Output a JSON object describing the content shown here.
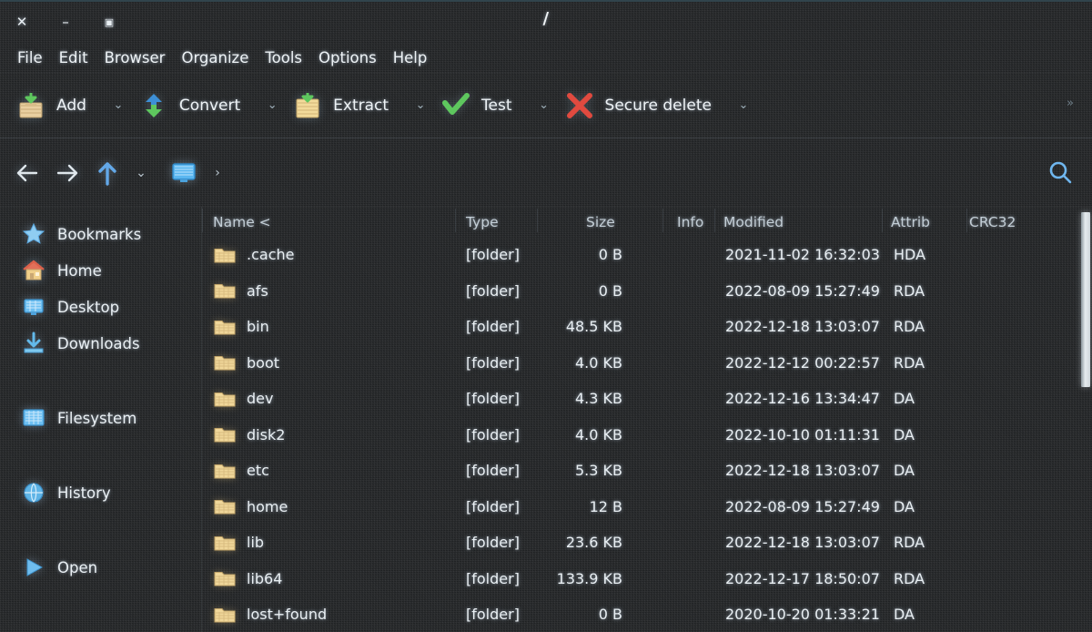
{
  "window": {
    "title": "/",
    "controls": [
      {
        "name": "close",
        "glyph": "✕"
      },
      {
        "name": "minimize",
        "glyph": "–"
      },
      {
        "name": "maximize",
        "glyph": "▣"
      }
    ]
  },
  "menubar": {
    "items": [
      {
        "label": "File"
      },
      {
        "label": "Edit"
      },
      {
        "label": "Browser"
      },
      {
        "label": "Organize"
      },
      {
        "label": "Tools"
      },
      {
        "label": "Options"
      },
      {
        "label": "Help"
      }
    ]
  },
  "toolbar": {
    "overflow_glyph": "»",
    "buttons": [
      {
        "label": "Add",
        "icon": "add-archive-icon",
        "caret": "⌄"
      },
      {
        "label": "Convert",
        "icon": "convert-icon",
        "caret": "⌄"
      },
      {
        "label": "Extract",
        "icon": "extract-icon",
        "caret": "⌄"
      },
      {
        "label": "Test",
        "icon": "test-checkmark-icon",
        "caret": "⌄"
      },
      {
        "label": "Secure delete",
        "icon": "secure-delete-icon",
        "caret": "⌄"
      }
    ]
  },
  "navbar": {
    "back_icon": "back-arrow-icon",
    "forward_icon": "forward-arrow-icon",
    "up_icon": "up-arrow-icon",
    "history_caret": "⌄",
    "computer_icon": "computer-icon",
    "path_caret": "›",
    "search_icon": "search-icon"
  },
  "sidebar": {
    "items": [
      {
        "label": "Bookmarks",
        "icon": "star-icon"
      },
      {
        "label": "Home",
        "icon": "house-icon"
      },
      {
        "label": "Desktop",
        "icon": "desktop-icon"
      },
      {
        "label": "Downloads",
        "icon": "download-icon"
      },
      {
        "label": "Filesystem",
        "icon": "drive-icon"
      },
      {
        "label": "History",
        "icon": "history-globe-icon"
      },
      {
        "label": "Open",
        "icon": "open-play-icon"
      }
    ]
  },
  "filelist": {
    "columns": [
      {
        "key": "name",
        "label": "Name <"
      },
      {
        "key": "type",
        "label": "Type"
      },
      {
        "key": "size",
        "label": "Size"
      },
      {
        "key": "info",
        "label": "Info"
      },
      {
        "key": "modified",
        "label": "Modified"
      },
      {
        "key": "attrib",
        "label": "Attrib"
      },
      {
        "key": "crc32",
        "label": "CRC32"
      }
    ],
    "rows": [
      {
        "name": ".cache",
        "type": "[folder]",
        "size": "0 B",
        "info": "",
        "modified": "2021-11-02 16:32:03",
        "attrib": "HDA",
        "crc32": ""
      },
      {
        "name": "afs",
        "type": "[folder]",
        "size": "0 B",
        "info": "",
        "modified": "2022-08-09 15:27:49",
        "attrib": "RDA",
        "crc32": ""
      },
      {
        "name": "bin",
        "type": "[folder]",
        "size": "48.5 KB",
        "info": "",
        "modified": "2022-12-18 13:03:07",
        "attrib": "RDA",
        "crc32": ""
      },
      {
        "name": "boot",
        "type": "[folder]",
        "size": "4.0 KB",
        "info": "",
        "modified": "2022-12-12 00:22:57",
        "attrib": "RDA",
        "crc32": ""
      },
      {
        "name": "dev",
        "type": "[folder]",
        "size": "4.3 KB",
        "info": "",
        "modified": "2022-12-16 13:34:47",
        "attrib": "DA",
        "crc32": ""
      },
      {
        "name": "disk2",
        "type": "[folder]",
        "size": "4.0 KB",
        "info": "",
        "modified": "2022-10-10 01:11:31",
        "attrib": "DA",
        "crc32": ""
      },
      {
        "name": "etc",
        "type": "[folder]",
        "size": "5.3 KB",
        "info": "",
        "modified": "2022-12-18 13:03:07",
        "attrib": "DA",
        "crc32": ""
      },
      {
        "name": "home",
        "type": "[folder]",
        "size": "12 B",
        "info": "",
        "modified": "2022-08-09 15:27:49",
        "attrib": "DA",
        "crc32": ""
      },
      {
        "name": "lib",
        "type": "[folder]",
        "size": "23.6 KB",
        "info": "",
        "modified": "2022-12-18 13:03:07",
        "attrib": "RDA",
        "crc32": ""
      },
      {
        "name": "lib64",
        "type": "[folder]",
        "size": "133.9 KB",
        "info": "",
        "modified": "2022-12-17 18:50:07",
        "attrib": "RDA",
        "crc32": ""
      },
      {
        "name": "lost+found",
        "type": "[folder]",
        "size": "0 B",
        "info": "",
        "modified": "2020-10-20 01:33:21",
        "attrib": "DA",
        "crc32": ""
      }
    ]
  },
  "colors": {
    "background": "#242628",
    "titlebar_accent": "#31444c",
    "text": "#eef3f6",
    "folder_icon": "#f0d79a",
    "accent_blue": "#5aa8e0",
    "accent_green": "#5ec75e",
    "accent_red": "#e04a3f"
  }
}
